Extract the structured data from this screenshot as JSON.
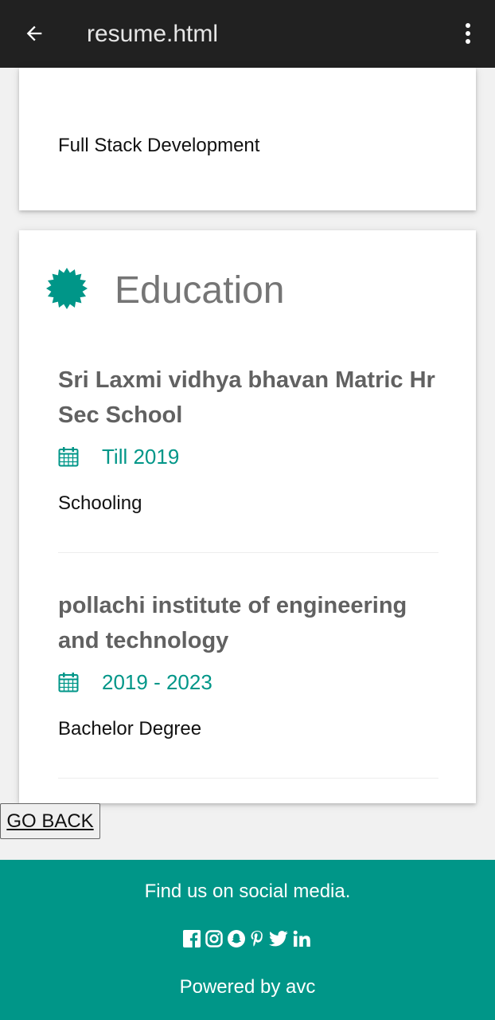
{
  "appbar": {
    "title": "resume.html",
    "back_icon": "arrow-left-icon",
    "menu_icon": "more-vert-icon"
  },
  "skills_card": {
    "item": "Full Stack Development"
  },
  "education": {
    "title": "Education",
    "icon": "badge-star-icon",
    "entries": [
      {
        "school": "Sri Laxmi vidhya bhavan Matric Hr Sec School",
        "dates": "Till 2019",
        "description": "Schooling"
      },
      {
        "school": "pollachi institute of engineering and technology",
        "dates": "2019 - 2023",
        "description": "Bachelor Degree"
      }
    ]
  },
  "go_back_label": "GO BACK",
  "footer": {
    "find_text": "Find us on social media.",
    "social_icons": [
      "facebook-icon",
      "instagram-icon",
      "snapchat-icon",
      "pinterest-icon",
      "twitter-icon",
      "linkedin-icon"
    ],
    "powered_text": "Powered by avc"
  },
  "colors": {
    "accent": "#009688",
    "appbar": "#212121",
    "heading": "#757575",
    "background": "#f1f1f1"
  }
}
